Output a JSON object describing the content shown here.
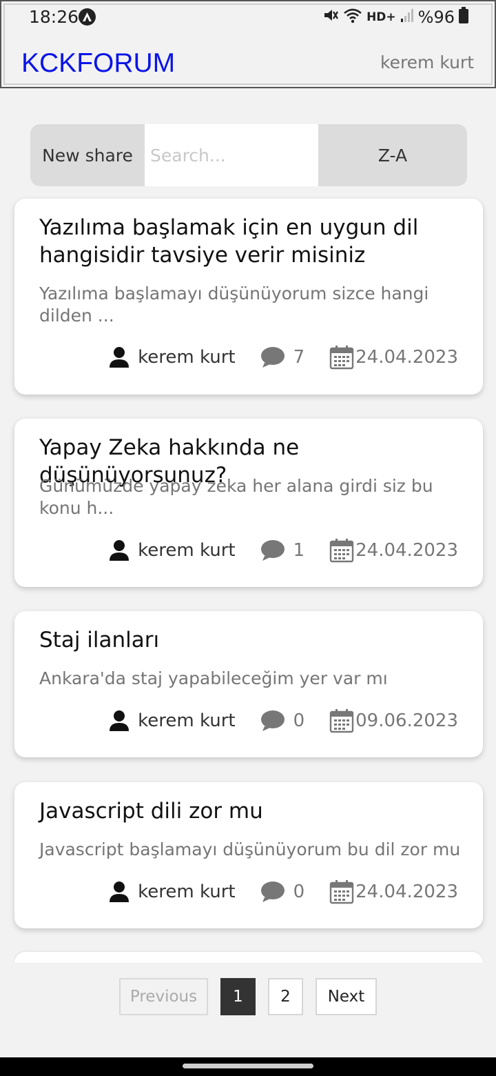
{
  "status_bar": {
    "time": "18:26",
    "hd_label": "HD+",
    "battery": "%96"
  },
  "header": {
    "brand": "KCKFORUM",
    "user": "kerem kurt"
  },
  "toolbar": {
    "new_share_label": "New share",
    "search_placeholder": "Search...",
    "sort_label": "Z-A"
  },
  "posts": [
    {
      "title": "Yazılıma başlamak için en uygun dil hangisidir tavsiye verir misiniz",
      "excerpt": "Yazılıma başlamayı düşünüyorum sizce hangi dilden ...",
      "author": "kerem kurt",
      "comments": "7",
      "date": "24.04.2023"
    },
    {
      "title": "Yapay Zeka hakkında ne düşünüyorsunuz?",
      "excerpt": "Günümüzde yapay zeka her alana girdi siz bu konu h...",
      "author": "kerem kurt",
      "comments": "1",
      "date": "24.04.2023"
    },
    {
      "title": "Staj ilanları",
      "excerpt": "Ankara'da staj yapabileceğim yer var mı",
      "author": "kerem kurt",
      "comments": "0",
      "date": "09.06.2023"
    },
    {
      "title": "Javascript dili zor mu",
      "excerpt": "Javascript başlamayı düşünüyorum bu dil zor mu",
      "author": "kerem kurt",
      "comments": "0",
      "date": "24.04.2023"
    }
  ],
  "pagination": {
    "previous_label": "Previous",
    "pages": [
      "1",
      "2"
    ],
    "current_page": "1",
    "next_label": "Next"
  },
  "colors": {
    "brand": "#0a14e8",
    "background": "#f2f2f2",
    "active_page": "#333333"
  },
  "icons": {
    "author": "person-icon",
    "comments": "speech-bubble-icon",
    "date": "calendar-icon"
  }
}
